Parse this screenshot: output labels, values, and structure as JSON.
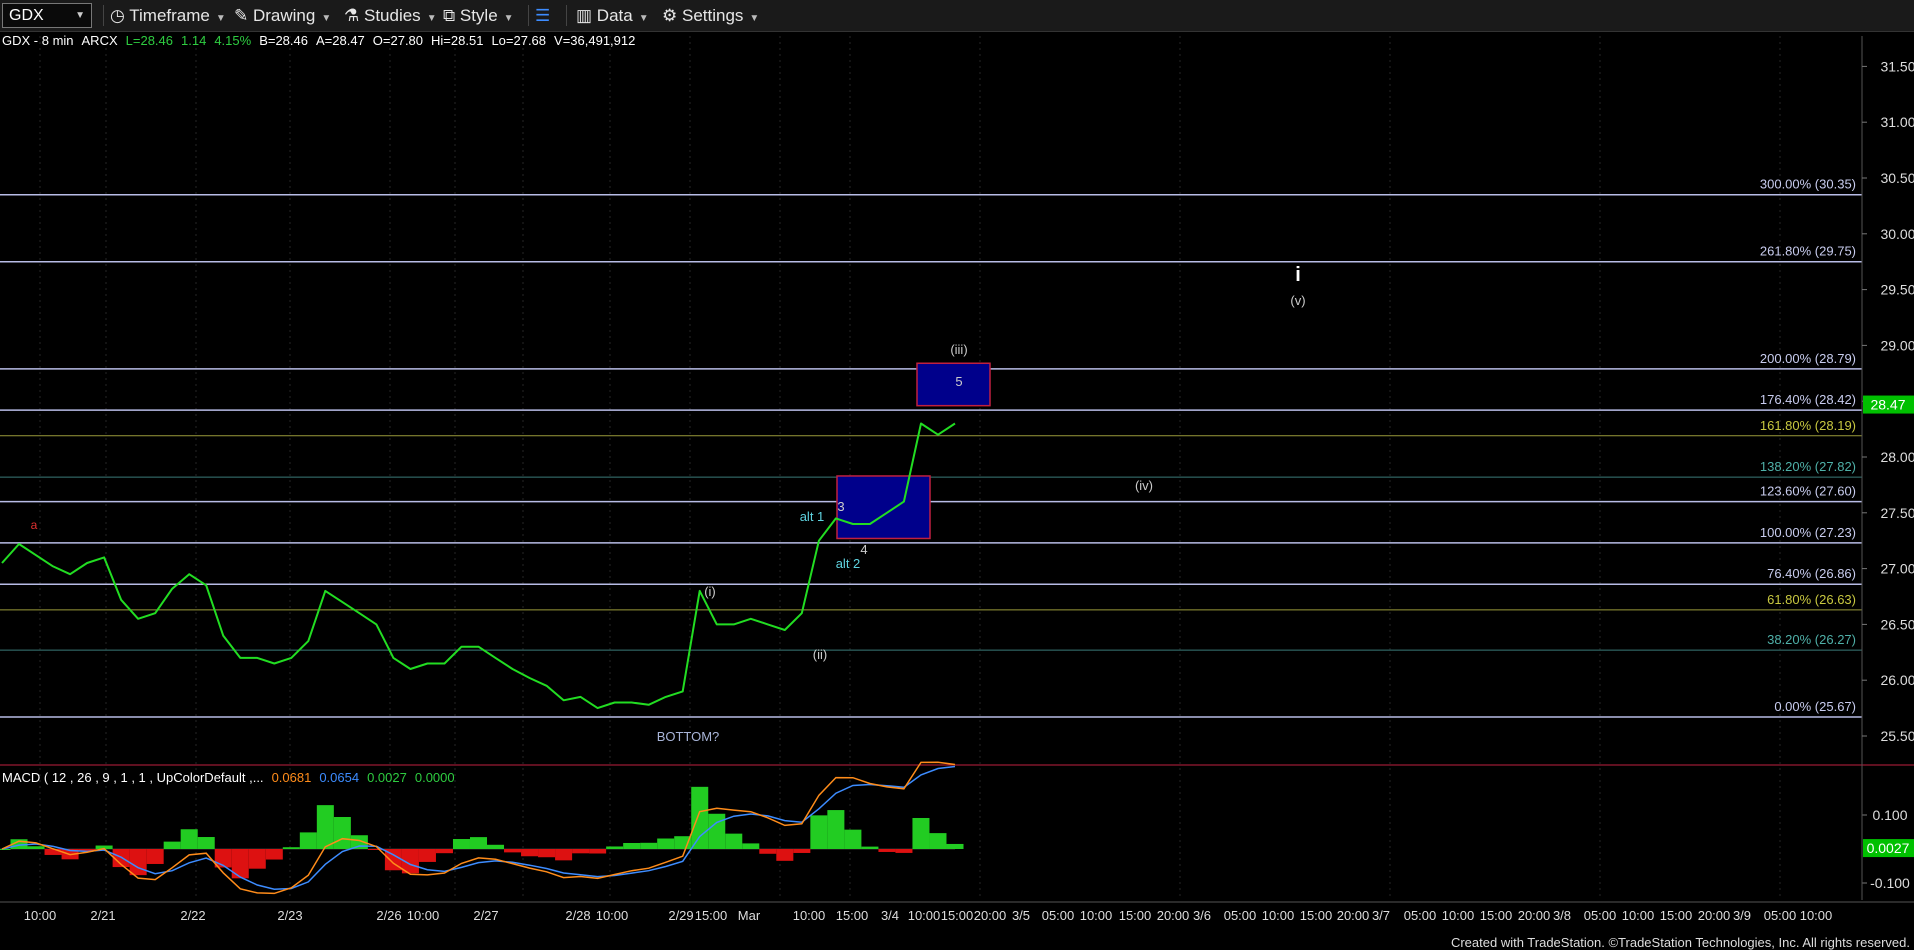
{
  "toolbar": {
    "symbol": "GDX",
    "items": [
      {
        "label": "Timeframe",
        "icon": "timeframe-icon"
      },
      {
        "label": "Drawing",
        "icon": "drawing-icon"
      },
      {
        "label": "Studies",
        "icon": "studies-icon"
      },
      {
        "label": "Style",
        "icon": "style-icon"
      },
      {
        "label": "",
        "icon": "layout-icon"
      },
      {
        "label": "Data",
        "icon": "data-icon"
      },
      {
        "label": "Settings",
        "icon": "gear-icon"
      }
    ]
  },
  "header": {
    "title": "GDX - 8 min",
    "exchange": "ARCX",
    "last": "L=28.46",
    "change": "1.14",
    "change_pct": "4.15%",
    "bid": "B=28.46",
    "ask": "A=28.47",
    "open": "O=27.80",
    "high": "Hi=28.51",
    "low": "Lo=27.68",
    "volume": "V=36,491,912"
  },
  "macd_header": {
    "label": "MACD ( 12 , 26 , 9 , 1 , 1 , UpColorDefault ,...",
    "v1": "0.0681",
    "v2": "0.0654",
    "v3": "0.0027",
    "v4": "0.0000"
  },
  "colors": {
    "price": "#22dd22",
    "fib_blue": "#b8bce6",
    "fib_olive": "#9a9a3a",
    "fib_teal": "#3a7a78",
    "box_fill": "#00008b",
    "box_border": "#c02040",
    "macd_line": "#ff8c1a",
    "signal_line": "#3d8cff",
    "hist_pos": "#22cc22",
    "hist_neg": "#dd1111",
    "axis_green": "#00c000"
  },
  "chart_data": {
    "type": "line",
    "y_axis_ticks": [
      "31.50",
      "31.00",
      "30.50",
      "30.00",
      "29.50",
      "29.00",
      "28.50",
      "28.00",
      "27.50",
      "27.00",
      "26.50",
      "26.00",
      "25.50"
    ],
    "ylim": [
      25.4,
      31.7
    ],
    "current_price_label": "28.47",
    "macd_axis_ticks": [
      "0.100",
      "-0.100"
    ],
    "macd_current_label": "0.0027",
    "x_tick_labels": [
      "10:00",
      "2/21",
      "2/22",
      "2/23",
      "2/26",
      "10:00",
      "2/27",
      "2/28",
      "10:00",
      "2/29",
      "15:00",
      "Mar",
      "10:00",
      "15:00",
      "3/4",
      "10:00",
      "15:00",
      "20:00",
      "3/5",
      "05:00",
      "10:00",
      "15:00",
      "20:00",
      "3/6",
      "05:00",
      "10:00",
      "15:00",
      "20:00",
      "3/7",
      "05:00",
      "10:00",
      "15:00",
      "20:00",
      "3/8",
      "05:00",
      "10:00",
      "15:00",
      "20:00",
      "3/9",
      "05:00",
      "10:00"
    ],
    "fib_levels": [
      {
        "label": "300.00% (30.35)",
        "value": 30.35,
        "color": "blue"
      },
      {
        "label": "261.80% (29.75)",
        "value": 29.75,
        "color": "blue"
      },
      {
        "label": "200.00% (28.79)",
        "value": 28.79,
        "color": "blue"
      },
      {
        "label": "176.40% (28.42)",
        "value": 28.42,
        "color": "blue"
      },
      {
        "label": "161.80% (28.19)",
        "value": 28.19,
        "color": "olive"
      },
      {
        "label": "138.20% (27.82)",
        "value": 27.82,
        "color": "teal"
      },
      {
        "label": "123.60% (27.60)",
        "value": 27.6,
        "color": "blue"
      },
      {
        "label": "100.00% (27.23)",
        "value": 27.23,
        "color": "blue"
      },
      {
        "label": "76.40% (26.86)",
        "value": 26.86,
        "color": "blue"
      },
      {
        "label": "61.80% (26.63)",
        "value": 26.63,
        "color": "olive"
      },
      {
        "label": "38.20% (26.27)",
        "value": 26.27,
        "color": "teal"
      },
      {
        "label": "0.00% (25.67)",
        "value": 25.67,
        "color": "blue"
      }
    ],
    "wave_labels": [
      {
        "text": "a",
        "color": "#e03030"
      },
      {
        "text": "(i)",
        "color": "#cccccc"
      },
      {
        "text": "(ii)",
        "color": "#cccccc"
      },
      {
        "text": "alt 1",
        "color": "#5fd3e0"
      },
      {
        "text": "3",
        "color": "#cccccc"
      },
      {
        "text": "4",
        "color": "#cccccc"
      },
      {
        "text": "alt 2",
        "color": "#5fd3e0"
      },
      {
        "text": "(iii)",
        "color": "#cccccc"
      },
      {
        "text": "5",
        "color": "#cccccc"
      },
      {
        "text": "(iv)",
        "color": "#cccccc"
      },
      {
        "text": "i",
        "color": "#ffffff"
      },
      {
        "text": "(v)",
        "color": "#cccccc"
      },
      {
        "text": "BOTTOM?",
        "color": "#a8b4d8"
      }
    ],
    "price_series": [
      27.05,
      27.22,
      27.12,
      27.02,
      26.95,
      27.05,
      27.1,
      26.72,
      26.55,
      26.6,
      26.82,
      26.95,
      26.85,
      26.4,
      26.2,
      26.2,
      26.15,
      26.2,
      26.35,
      26.8,
      26.7,
      26.6,
      26.5,
      26.2,
      26.1,
      26.15,
      26.15,
      26.3,
      26.3,
      26.2,
      26.1,
      26.02,
      25.95,
      25.82,
      25.85,
      25.75,
      25.8,
      25.8,
      25.78,
      25.85,
      25.9,
      26.8,
      26.5,
      26.5,
      26.55,
      26.5,
      26.45,
      26.6,
      27.25,
      27.45,
      27.4,
      27.4,
      27.5,
      27.6,
      28.3,
      28.2,
      28.3
    ]
  },
  "footer": "Created with TradeStation. ©TradeStation Technologies, Inc. All rights reserved."
}
